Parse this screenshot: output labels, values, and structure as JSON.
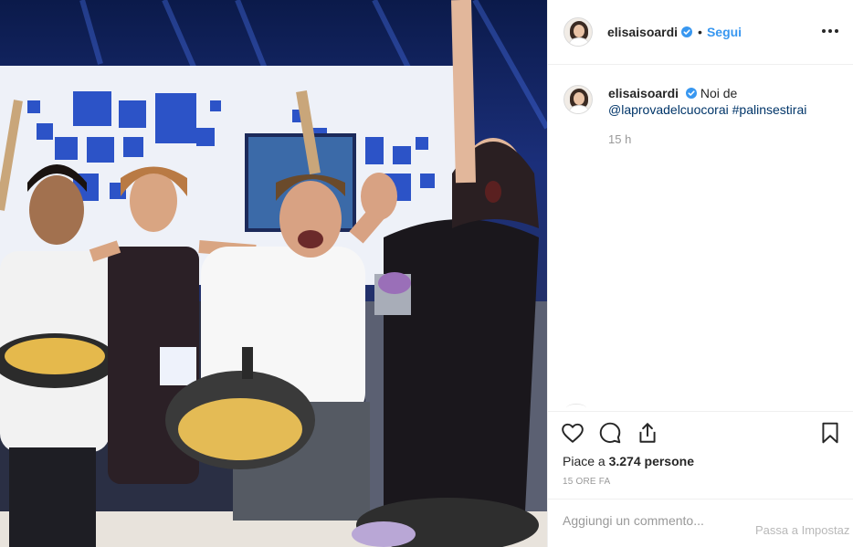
{
  "post": {
    "username": "elisaisoardi",
    "follow_label": "Segui",
    "separator": "•",
    "caption_intro": "Noi de",
    "mention": "@laprovadelcuocorai",
    "hashtag": "#palinsestirai",
    "time_ago": "15 h",
    "likes_prefix": "Piace a",
    "likes_count": "3.274 persone",
    "timestamp": "15 ORE FA",
    "comment_placeholder": "Aggiungi un commento...",
    "overlay_text": "Passa a Impostaz"
  },
  "icons": {
    "verified": "verified-badge-icon",
    "more": "more-options-icon",
    "like": "heart-icon",
    "comment": "comment-icon",
    "share": "share-icon",
    "save": "bookmark-icon"
  },
  "colors": {
    "link_blue": "#003569",
    "follow_blue": "#3897f0",
    "text": "#262626",
    "muted": "#999999",
    "border": "#efefef"
  }
}
